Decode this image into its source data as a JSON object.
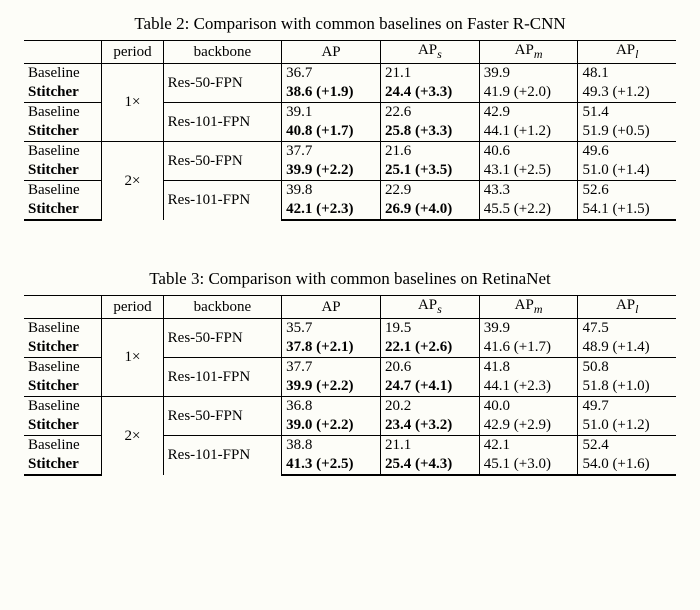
{
  "tables": [
    {
      "caption": "Table 2: Comparison with common baselines on Faster R-CNN",
      "headers": {
        "method": "",
        "period": "period",
        "backbone": "backbone",
        "AP": "AP",
        "APs": "AP",
        "APs_sub": "s",
        "APm": "AP",
        "APm_sub": "m",
        "APl": "AP",
        "APl_sub": "l"
      },
      "groups": [
        {
          "period": "1×",
          "pairs": [
            {
              "backbone": "Res-50-FPN",
              "baseline": {
                "AP": "36.7",
                "APs": "21.1",
                "APm": "39.9",
                "APl": "48.1"
              },
              "stitcher": {
                "AP": "38.6 (+1.9)",
                "APs": "24.4 (+3.3)",
                "APm": "41.9 (+2.0)",
                "APl": "49.3 (+1.2)"
              }
            },
            {
              "backbone": "Res-101-FPN",
              "baseline": {
                "AP": "39.1",
                "APs": "22.6",
                "APm": "42.9",
                "APl": "51.4"
              },
              "stitcher": {
                "AP": "40.8 (+1.7)",
                "APs": "25.8 (+3.3)",
                "APm": "44.1 (+1.2)",
                "APl": "51.9 (+0.5)"
              }
            }
          ]
        },
        {
          "period": "2×",
          "pairs": [
            {
              "backbone": "Res-50-FPN",
              "baseline": {
                "AP": "37.7",
                "APs": "21.6",
                "APm": "40.6",
                "APl": "49.6"
              },
              "stitcher": {
                "AP": "39.9 (+2.2)",
                "APs": "25.1 (+3.5)",
                "APm": "43.1 (+2.5)",
                "APl": "51.0 (+1.4)"
              }
            },
            {
              "backbone": "Res-101-FPN",
              "baseline": {
                "AP": "39.8",
                "APs": "22.9",
                "APm": "43.3",
                "APl": "52.6"
              },
              "stitcher": {
                "AP": "42.1 (+2.3)",
                "APs": "26.9 (+4.0)",
                "APm": "45.5 (+2.2)",
                "APl": "54.1 (+1.5)"
              }
            }
          ]
        }
      ],
      "labels": {
        "baseline": "Baseline",
        "stitcher": "Stitcher"
      }
    },
    {
      "caption": "Table 3: Comparison with common baselines on RetinaNet",
      "headers": {
        "method": "",
        "period": "period",
        "backbone": "backbone",
        "AP": "AP",
        "APs": "AP",
        "APs_sub": "s",
        "APm": "AP",
        "APm_sub": "m",
        "APl": "AP",
        "APl_sub": "l"
      },
      "groups": [
        {
          "period": "1×",
          "pairs": [
            {
              "backbone": "Res-50-FPN",
              "baseline": {
                "AP": "35.7",
                "APs": "19.5",
                "APm": "39.9",
                "APl": "47.5"
              },
              "stitcher": {
                "AP": "37.8 (+2.1)",
                "APs": "22.1 (+2.6)",
                "APm": "41.6 (+1.7)",
                "APl": "48.9 (+1.4)"
              }
            },
            {
              "backbone": "Res-101-FPN",
              "baseline": {
                "AP": "37.7",
                "APs": "20.6",
                "APm": "41.8",
                "APl": "50.8"
              },
              "stitcher": {
                "AP": "39.9 (+2.2)",
                "APs": "24.7 (+4.1)",
                "APm": "44.1 (+2.3)",
                "APl": "51.8 (+1.0)"
              }
            }
          ]
        },
        {
          "period": "2×",
          "pairs": [
            {
              "backbone": "Res-50-FPN",
              "baseline": {
                "AP": "36.8",
                "APs": "20.2",
                "APm": "40.0",
                "APl": "49.7"
              },
              "stitcher": {
                "AP": "39.0 (+2.2)",
                "APs": "23.4 (+3.2)",
                "APm": "42.9 (+2.9)",
                "APl": "51.0 (+1.2)"
              }
            },
            {
              "backbone": "Res-101-FPN",
              "baseline": {
                "AP": "38.8",
                "APs": "21.1",
                "APm": "42.1",
                "APl": "52.4"
              },
              "stitcher": {
                "AP": "41.3 (+2.5)",
                "APs": "25.4 (+4.3)",
                "APm": "45.1 (+3.0)",
                "APl": "54.0 (+1.6)"
              }
            }
          ]
        }
      ],
      "labels": {
        "baseline": "Baseline",
        "stitcher": "Stitcher"
      }
    }
  ],
  "chart_data": [
    {
      "type": "table",
      "title": "Comparison with common baselines on Faster R-CNN",
      "columns": [
        "method",
        "period",
        "backbone",
        "AP",
        "APs",
        "APm",
        "APl"
      ],
      "rows": [
        [
          "Baseline",
          "1×",
          "Res-50-FPN",
          36.7,
          21.1,
          39.9,
          48.1
        ],
        [
          "Stitcher",
          "1×",
          "Res-50-FPN",
          38.6,
          24.4,
          41.9,
          49.3
        ],
        [
          "Baseline",
          "1×",
          "Res-101-FPN",
          39.1,
          22.6,
          42.9,
          51.4
        ],
        [
          "Stitcher",
          "1×",
          "Res-101-FPN",
          40.8,
          25.8,
          44.1,
          51.9
        ],
        [
          "Baseline",
          "2×",
          "Res-50-FPN",
          37.7,
          21.6,
          40.6,
          49.6
        ],
        [
          "Stitcher",
          "2×",
          "Res-50-FPN",
          39.9,
          25.1,
          43.1,
          51.0
        ],
        [
          "Baseline",
          "2×",
          "Res-101-FPN",
          39.8,
          22.9,
          43.3,
          52.6
        ],
        [
          "Stitcher",
          "2×",
          "Res-101-FPN",
          42.1,
          26.9,
          45.5,
          54.1
        ]
      ]
    },
    {
      "type": "table",
      "title": "Comparison with common baselines on RetinaNet",
      "columns": [
        "method",
        "period",
        "backbone",
        "AP",
        "APs",
        "APm",
        "APl"
      ],
      "rows": [
        [
          "Baseline",
          "1×",
          "Res-50-FPN",
          35.7,
          19.5,
          39.9,
          47.5
        ],
        [
          "Stitcher",
          "1×",
          "Res-50-FPN",
          37.8,
          22.1,
          41.6,
          48.9
        ],
        [
          "Baseline",
          "1×",
          "Res-101-FPN",
          37.7,
          20.6,
          41.8,
          50.8
        ],
        [
          "Stitcher",
          "1×",
          "Res-101-FPN",
          39.9,
          24.7,
          44.1,
          51.8
        ],
        [
          "Baseline",
          "2×",
          "Res-50-FPN",
          36.8,
          20.2,
          40.0,
          49.7
        ],
        [
          "Stitcher",
          "2×",
          "Res-50-FPN",
          39.0,
          23.4,
          42.9,
          51.0
        ],
        [
          "Baseline",
          "2×",
          "Res-101-FPN",
          38.8,
          21.1,
          42.1,
          52.4
        ],
        [
          "Stitcher",
          "2×",
          "Res-101-FPN",
          41.3,
          25.4,
          45.1,
          54.0
        ]
      ]
    }
  ]
}
